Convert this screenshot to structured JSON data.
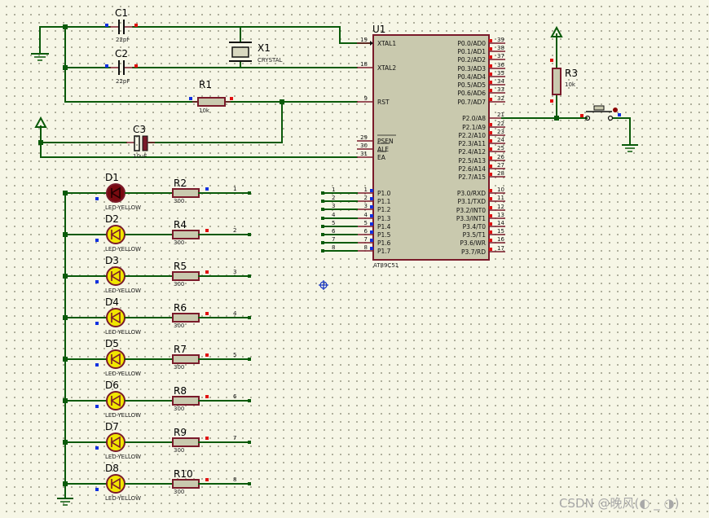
{
  "components": {
    "c1": {
      "ref": "C1",
      "value": "22pf"
    },
    "c2": {
      "ref": "C2",
      "value": "22pF"
    },
    "c3": {
      "ref": "C3",
      "value": "10uF"
    },
    "x1": {
      "ref": "X1",
      "value": "CRYSTAL"
    },
    "r1": {
      "ref": "R1",
      "value": "10k"
    },
    "r3": {
      "ref": "R3",
      "value": "10k"
    },
    "u1": {
      "ref": "U1",
      "part": "AT89C51"
    }
  },
  "u1_left_pins": [
    {
      "num": "19",
      "name": "XTAL1"
    },
    {
      "num": "18",
      "name": "XTAL2"
    },
    {
      "num": "9",
      "name": "RST"
    },
    {
      "num": "29",
      "name": "PSEN"
    },
    {
      "num": "30",
      "name": "ALE"
    },
    {
      "num": "31",
      "name": "EA"
    },
    {
      "num": "1",
      "name": "P1.0"
    },
    {
      "num": "2",
      "name": "P1.1"
    },
    {
      "num": "3",
      "name": "P1.2"
    },
    {
      "num": "4",
      "name": "P1.3"
    },
    {
      "num": "5",
      "name": "P1.4"
    },
    {
      "num": "6",
      "name": "P1.5"
    },
    {
      "num": "7",
      "name": "P1.6"
    },
    {
      "num": "8",
      "name": "P1.7"
    }
  ],
  "u1_right_pins": [
    {
      "num": "39",
      "name": "P0.0/AD0"
    },
    {
      "num": "38",
      "name": "P0.1/AD1"
    },
    {
      "num": "37",
      "name": "P0.2/AD2"
    },
    {
      "num": "36",
      "name": "P0.3/AD3"
    },
    {
      "num": "35",
      "name": "P0.4/AD4"
    },
    {
      "num": "34",
      "name": "P0.5/AD5"
    },
    {
      "num": "33",
      "name": "P0.6/AD6"
    },
    {
      "num": "32",
      "name": "P0.7/AD7"
    },
    {
      "num": "21",
      "name": "P2.0/A8"
    },
    {
      "num": "22",
      "name": "P2.1/A9"
    },
    {
      "num": "23",
      "name": "P2.2/A10"
    },
    {
      "num": "24",
      "name": "P2.3/A11"
    },
    {
      "num": "25",
      "name": "P2.4/A12"
    },
    {
      "num": "26",
      "name": "P2.5/A13"
    },
    {
      "num": "27",
      "name": "P2.6/A14"
    },
    {
      "num": "28",
      "name": "P2.7/A15"
    },
    {
      "num": "10",
      "name": "P3.0/RXD"
    },
    {
      "num": "11",
      "name": "P3.1/TXD"
    },
    {
      "num": "12",
      "name": "P3.2/INT0"
    },
    {
      "num": "13",
      "name": "P3.3/INT1"
    },
    {
      "num": "14",
      "name": "P3.4/T0"
    },
    {
      "num": "15",
      "name": "P3.5/T1"
    },
    {
      "num": "16",
      "name": "P3.6/WR"
    },
    {
      "num": "17",
      "name": "P3.7/RD"
    }
  ],
  "p1_net_labels": [
    "1",
    "2",
    "3",
    "4",
    "5",
    "6",
    "7",
    "8"
  ],
  "leds": [
    {
      "led": "D1",
      "resistor": "R2",
      "led_value": "LED-YELLOW",
      "res_value": "300",
      "net": "1",
      "lit": true
    },
    {
      "led": "D2",
      "resistor": "R4",
      "led_value": "LED-YELLOW",
      "res_value": "300",
      "net": "2",
      "lit": false
    },
    {
      "led": "D3",
      "resistor": "R5",
      "led_value": "LED-YELLOW",
      "res_value": "300",
      "net": "3",
      "lit": false
    },
    {
      "led": "D4",
      "resistor": "R6",
      "led_value": "LED-YELLOW",
      "res_value": "300",
      "net": "4",
      "lit": false
    },
    {
      "led": "D5",
      "resistor": "R7",
      "led_value": "LED-YELLOW",
      "res_value": "300",
      "net": "5",
      "lit": false
    },
    {
      "led": "D6",
      "resistor": "R8",
      "led_value": "LED-YELLOW",
      "res_value": "300",
      "net": "6",
      "lit": false
    },
    {
      "led": "D7",
      "resistor": "R9",
      "led_value": "LED-YELLOW",
      "res_value": "300",
      "net": "7",
      "lit": false
    },
    {
      "led": "D8",
      "resistor": "R10",
      "led_value": "LED-YELLOW",
      "res_value": "300",
      "net": "8",
      "lit": false
    }
  ],
  "watermark": "CSDN @晚风(◐ _ ◑)",
  "colors": {
    "wire": "#0a5a0a",
    "chip_fill": "#c9c9ae",
    "component": "#7a1a2a",
    "led_off": "#f1e600",
    "led_on": "#7a0a10",
    "pin_marker_red": "#e01010",
    "pin_marker_blue": "#1030e0"
  }
}
